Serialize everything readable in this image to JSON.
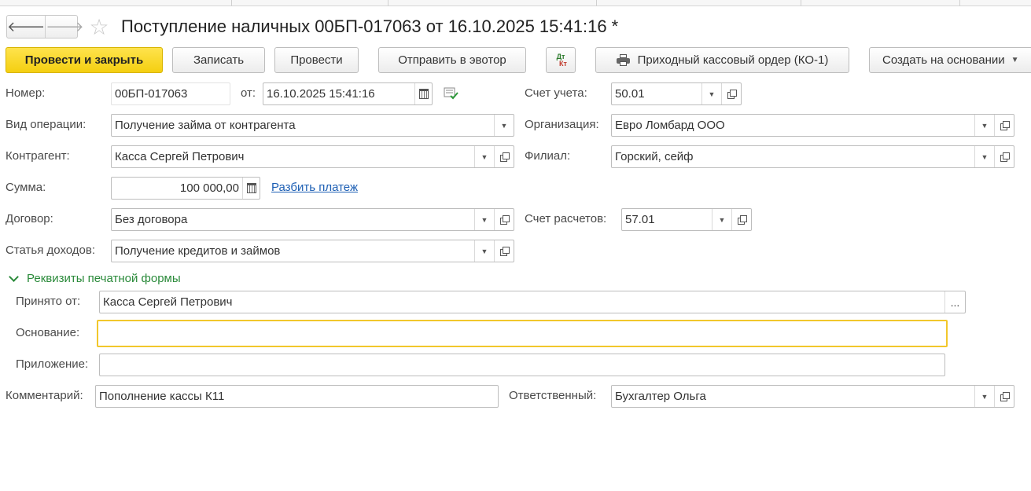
{
  "window": {
    "title": "Поступление наличных 00БП-017063 от 16.10.2025 15:41:16 *",
    "nav_back_icon": "arrow-left-icon",
    "nav_forward_icon": "arrow-right-icon",
    "favorite_icon": "star-icon"
  },
  "toolbar": {
    "post_and_close": "Провести и закрыть",
    "save": "Записать",
    "post": "Провести",
    "send_evotor": "Отправить в эвотор",
    "dt": "Дт",
    "kt": "Кт",
    "print_ko1": "Приходный кассовый ордер (КО-1)",
    "create_based": "Создать на основании",
    "create_based_caret": "▼"
  },
  "form": {
    "number": {
      "label": "Номер:",
      "value": "00БП-017063"
    },
    "date": {
      "label": "от:",
      "value": "16.10.2025 15:41:16"
    },
    "account": {
      "label": "Счет учета:",
      "value": "50.01"
    },
    "operation": {
      "label": "Вид операции:",
      "value": "Получение займа от контрагента"
    },
    "organization": {
      "label": "Организация:",
      "value": "Евро Ломбард ООО"
    },
    "counterparty": {
      "label": "Контрагент:",
      "value": "Касса Сергей Петрович"
    },
    "branch": {
      "label": "Филиал:",
      "value": "Горский, сейф"
    },
    "amount": {
      "label": "Сумма:",
      "value": "100 000,00",
      "split_link": "Разбить платеж"
    },
    "contract": {
      "label": "Договор:",
      "value": "Без договора"
    },
    "settlement_account": {
      "label": "Счет расчетов:",
      "value": "57.01"
    },
    "income_item": {
      "label": "Статья доходов:",
      "value": "Получение кредитов и займов"
    },
    "print_section": {
      "title": "Реквизиты печатной формы"
    },
    "received_from": {
      "label": "Принято от:",
      "value": "Касса Сергей Петрович",
      "button": "..."
    },
    "basis": {
      "label": "Основание:",
      "value": ""
    },
    "attachment": {
      "label": "Приложение:",
      "value": ""
    },
    "comment": {
      "label": "Комментарий:",
      "value": "Пополнение кассы К11"
    },
    "responsible": {
      "label": "Ответственный:",
      "value": "Бухгалтер Ольга"
    }
  }
}
